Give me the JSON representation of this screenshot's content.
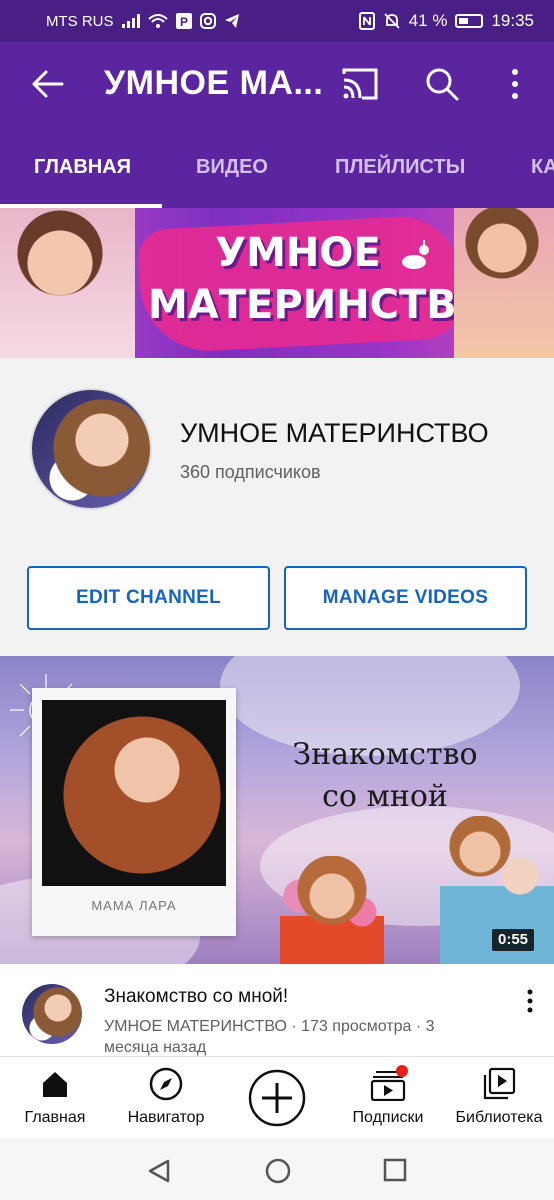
{
  "status_bar": {
    "carrier": "MTS RUS",
    "battery_percent": "41 %",
    "time": "19:35",
    "icons": [
      "signal-icon",
      "wifi-icon",
      "parking-icon",
      "instagram-icon",
      "telegram-icon",
      "nfc-icon",
      "mute-icon",
      "battery-icon"
    ]
  },
  "app_bar": {
    "title": "УМНОЕ МА...",
    "icons": [
      "back-arrow-icon",
      "cast-icon",
      "search-icon",
      "more-vert-icon"
    ]
  },
  "tabs": [
    {
      "label": "ГЛАВНАЯ",
      "active": true
    },
    {
      "label": "ВИДЕО",
      "active": false
    },
    {
      "label": "ПЛЕЙЛИСТЫ",
      "active": false
    },
    {
      "label": "КА",
      "active": false
    }
  ],
  "banner": {
    "line1": "УМНОЕ",
    "line2": "МАТЕРИНСТВО"
  },
  "channel": {
    "name": "УМНОЕ МАТЕРИНСТВО",
    "subscribers": "360 подписчиков",
    "edit_label": "EDIT CHANNEL",
    "manage_label": "MANAGE VIDEOS"
  },
  "featured_video": {
    "thumb_title_line1": "Знакомство",
    "thumb_title_line2": "со мной",
    "polaroid_caption": "МАМА ЛАРА",
    "duration": "0:55",
    "title": "Знакомство со мной!",
    "meta": "УМНОЕ МАТЕРИНСТВО · 173 просмотра · 3 месяца назад"
  },
  "bottom_nav": [
    {
      "label": "Главная",
      "icon": "home-icon"
    },
    {
      "label": "Навигатор",
      "icon": "compass-icon"
    },
    {
      "label": "",
      "icon": "add-icon"
    },
    {
      "label": "Подписки",
      "icon": "subscriptions-icon",
      "notification": true
    },
    {
      "label": "Библиотека",
      "icon": "library-icon"
    }
  ],
  "system_nav": [
    "back-triangle-icon",
    "home-circle-icon",
    "recents-square-icon"
  ],
  "colors": {
    "status_bar": "#4a1f85",
    "app_bar": "#5b259f",
    "link_blue": "#1565c0",
    "notification_red": "#e62117"
  }
}
